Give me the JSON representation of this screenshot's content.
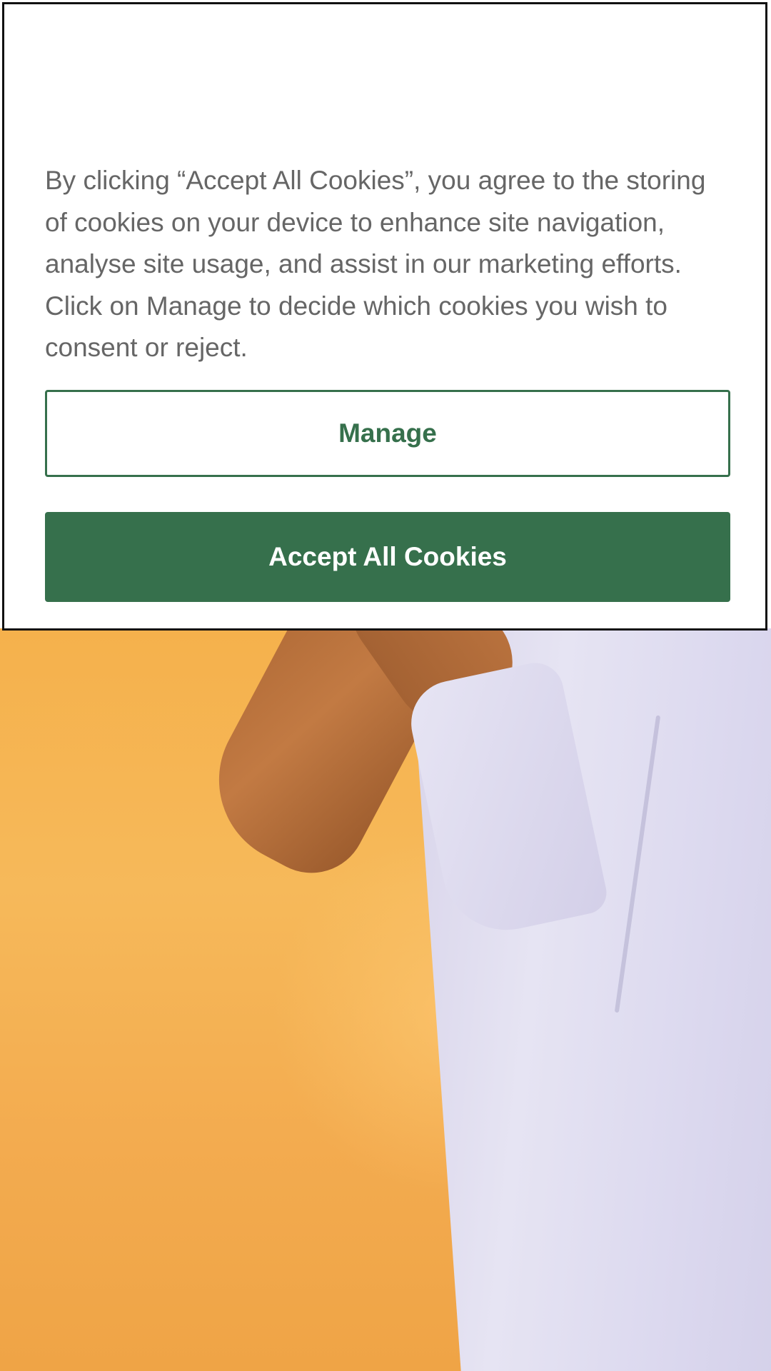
{
  "cookie_banner": {
    "message": "By clicking “Accept All Cookies”, you agree to the storing of cookies on your device to enhance site navigation, analyse site usage, and assist in our marketing efforts. Click on Manage to decide which cookies you wish to consent or reject.",
    "manage_label": "Manage",
    "accept_label": "Accept All Cookies"
  },
  "colors": {
    "brand_green": "#36704c",
    "body_text": "#666666",
    "hero_background": "#f5b14c"
  }
}
